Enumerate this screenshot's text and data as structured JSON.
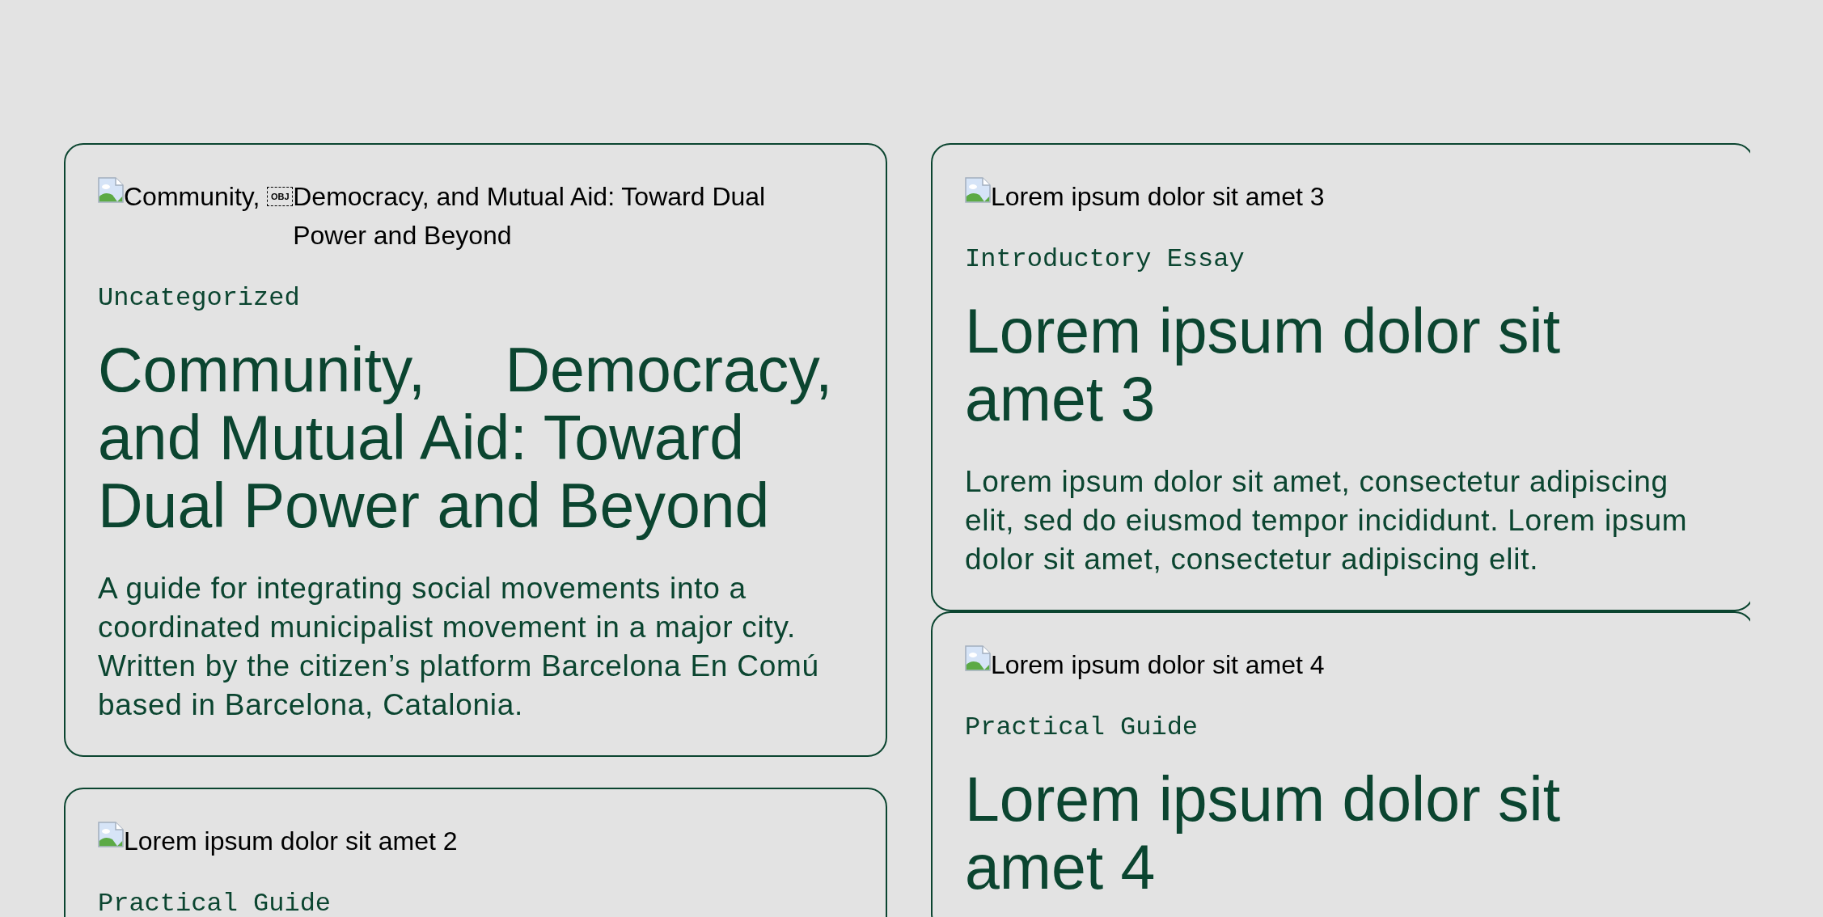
{
  "post_columns": [
    {
      "posts": [
        {
          "image_alt": [
            {
              "kind": "text",
              "text": "Community, "
            },
            {
              "kind": "object_marker",
              "text": "OBJ"
            },
            {
              "kind": "text",
              "text": "Democracy, and Mutual Aid: Toward Dual Power and Beyond"
            }
          ],
          "category": "Uncategorized",
          "title": "Community,  Democracy, and Mutual Aid: Toward Dual Power and Beyond",
          "summary": "A guide for integrating social movements into a coordinated municipalist movement in a major city. Written by the citizen’s platform Barcelona En Comú based in Barcelona, Catalonia."
        },
        {
          "image_alt": [
            {
              "kind": "text",
              "text": "Lorem ipsum dolor sit amet 2"
            }
          ],
          "category": "Practical Guide"
        }
      ]
    },
    {
      "posts": [
        {
          "image_alt": [
            {
              "kind": "text",
              "text": "Lorem ipsum dolor sit amet 3"
            }
          ],
          "category": "Introductory Essay",
          "title": "Lorem ipsum dolor sit amet 3",
          "summary": "Lorem ipsum dolor sit amet, consectetur adipiscing elit, sed do eiusmod tempor incididunt. Lorem ipsum dolor sit amet, consectetur adipiscing elit."
        },
        {
          "image_alt": [
            {
              "kind": "text",
              "text": "Lorem ipsum dolor sit amet 4"
            }
          ],
          "category": "Practical Guide",
          "title": "Lorem ipsum dolor sit amet 4"
        }
      ]
    }
  ]
}
